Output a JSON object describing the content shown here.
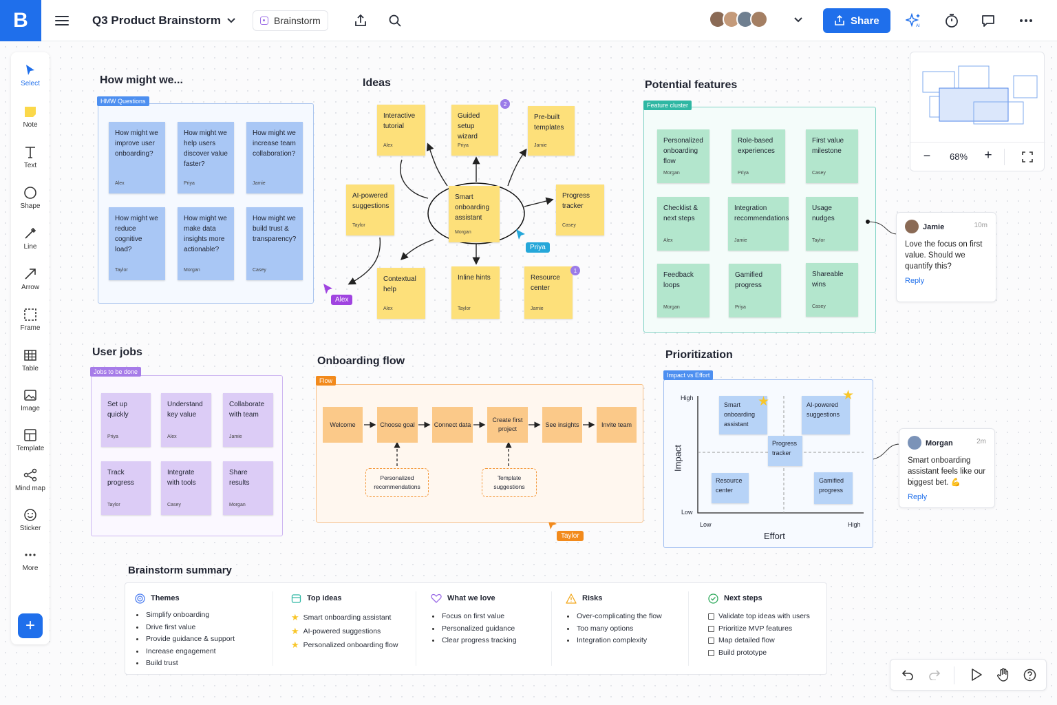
{
  "topbar": {
    "logo": "B",
    "doc_title": "Q3 Product Brainstorm",
    "board_chip": "Brainstorm",
    "share_label": "Share",
    "ai_label": "AI"
  },
  "tools": [
    {
      "label": "Select",
      "icon": "cursor-icon"
    },
    {
      "label": "Note",
      "icon": "note-icon"
    },
    {
      "label": "Text",
      "icon": "text-icon"
    },
    {
      "label": "Shape",
      "icon": "shape-icon"
    },
    {
      "label": "Line",
      "icon": "line-icon"
    },
    {
      "label": "Arrow",
      "icon": "arrow-icon"
    },
    {
      "label": "Frame",
      "icon": "frame-icon"
    },
    {
      "label": "Table",
      "icon": "table-icon"
    },
    {
      "label": "Image",
      "icon": "image-icon"
    },
    {
      "label": "Template",
      "icon": "template-icon"
    },
    {
      "label": "Mind map",
      "icon": "mind-map-icon"
    },
    {
      "label": "Sticker",
      "icon": "sticker-icon"
    },
    {
      "label": "More",
      "icon": "more-icon"
    }
  ],
  "hmw": {
    "title": "How might we...",
    "tag": "HMW Questions",
    "notes": [
      {
        "text": "How might we improve user onboarding?",
        "author": "Alex"
      },
      {
        "text": "How might we help users discover value faster?",
        "author": "Priya"
      },
      {
        "text": "How might we increase team collaboration?",
        "author": "Jamie"
      },
      {
        "text": "How might we reduce cognitive load?",
        "author": "Taylor"
      },
      {
        "text": "How might we make data insights more actionable?",
        "author": "Morgan"
      },
      {
        "text": "How might we build trust & transparency?",
        "author": "Casey"
      }
    ]
  },
  "ideas": {
    "title": "Ideas",
    "center": {
      "text": "Smart onboarding assistant",
      "author": "Morgan"
    },
    "notes": [
      {
        "text": "Interactive tutorial",
        "author": "Alex"
      },
      {
        "text": "Guided setup wizard",
        "author": "Priya",
        "badge": "2"
      },
      {
        "text": "Pre-built templates",
        "author": "Jamie"
      },
      {
        "text": "AI-powered suggestions",
        "author": "Taylor"
      },
      {
        "text": "Progress tracker",
        "author": "Casey"
      },
      {
        "text": "Contextual help",
        "author": "Alex"
      },
      {
        "text": "Inline hints",
        "author": "Taylor"
      },
      {
        "text": "Resource center",
        "author": "Jamie",
        "badge": "1"
      }
    ]
  },
  "cursors": {
    "alex": "Alex",
    "priya": "Priya",
    "taylor": "Taylor"
  },
  "features": {
    "title": "Potential features",
    "tag": "Feature cluster",
    "notes": [
      {
        "text": "Personalized onboarding flow",
        "author": "Morgan"
      },
      {
        "text": "Role-based experiences",
        "author": "Priya"
      },
      {
        "text": "First value milestone",
        "author": "Casey"
      },
      {
        "text": "Checklist & next steps",
        "author": "Alex"
      },
      {
        "text": "Integration recommendations",
        "author": "Jamie"
      },
      {
        "text": "Usage nudges",
        "author": "Taylor"
      },
      {
        "text": "Feedback loops",
        "author": "Morgan"
      },
      {
        "text": "Gamified progress",
        "author": "Priya"
      },
      {
        "text": "Shareable wins",
        "author": "Casey"
      }
    ]
  },
  "comments": [
    {
      "name": "Jamie",
      "time": "10m",
      "text": "Love the focus on first value. Should we quantify this?",
      "reply": "Reply"
    },
    {
      "name": "Morgan",
      "time": "2m",
      "text": "Smart onboarding assistant feels like our biggest bet. 💪",
      "reply": "Reply"
    }
  ],
  "minimap": {
    "zoom": "68%",
    "minus": "−",
    "plus": "+"
  },
  "user_jobs": {
    "title": "User jobs",
    "tag": "Jobs to be done",
    "notes": [
      {
        "text": "Set up quickly",
        "author": "Priya"
      },
      {
        "text": "Understand key value",
        "author": "Alex"
      },
      {
        "text": "Collaborate with team",
        "author": "Jamie"
      },
      {
        "text": "Track progress",
        "author": "Taylor"
      },
      {
        "text": "Integrate with tools",
        "author": "Casey"
      },
      {
        "text": "Share results",
        "author": "Morgan"
      }
    ]
  },
  "flow": {
    "title": "Onboarding flow",
    "tag": "Flow",
    "steps": [
      "Welcome",
      "Choose goal",
      "Connect data",
      "Create first project",
      "See insights",
      "Invite team"
    ],
    "branches": [
      "Personalized recommendations",
      "Template suggestions"
    ]
  },
  "prioritization": {
    "title": "Prioritization",
    "tag": "Impact vs Effort",
    "y_axis": "Impact",
    "x_axis": "Effort",
    "high_y": "High",
    "low_y": "Low",
    "low_x": "Low",
    "high_x": "High",
    "items": [
      {
        "text": "Smart onboarding assistant",
        "star": true
      },
      {
        "text": "AI-powered suggestions",
        "star": true
      },
      {
        "text": "Progress tracker",
        "star": false
      },
      {
        "text": "Resource center",
        "star": false
      },
      {
        "text": "Gamified progress",
        "star": false
      }
    ]
  },
  "summary": {
    "title": "Brainstorm summary",
    "columns": [
      {
        "title": "Themes",
        "icon": "target-icon",
        "items": [
          "Simplify onboarding",
          "Drive first value",
          "Provide guidance & support",
          "Increase engagement",
          "Build trust"
        ]
      },
      {
        "title": "Top ideas",
        "icon": "box-icon",
        "items": [
          "Smart onboarding assistant",
          "AI-powered suggestions",
          "Personalized onboarding flow"
        ]
      },
      {
        "title": "What we love",
        "icon": "heart-icon",
        "items": [
          "Focus on first value",
          "Personalized guidance",
          "Clear progress tracking"
        ]
      },
      {
        "title": "Risks",
        "icon": "warning-icon",
        "items": [
          "Over-complicating the flow",
          "Too many options",
          "Integration complexity"
        ]
      },
      {
        "title": "Next steps",
        "icon": "check-circle-icon",
        "items": [
          "Validate top ideas with users",
          "Prioritize MVP features",
          "Map detailed flow",
          "Build prototype"
        ]
      }
    ]
  },
  "colors": {
    "accent": "#1f6feb",
    "sticky_blue": "#a9c7f5",
    "sticky_yellow": "#fde07a",
    "sticky_green": "#b3e6cd",
    "sticky_purple": "#dcccf6",
    "sticky_orange": "#fbcb91"
  }
}
